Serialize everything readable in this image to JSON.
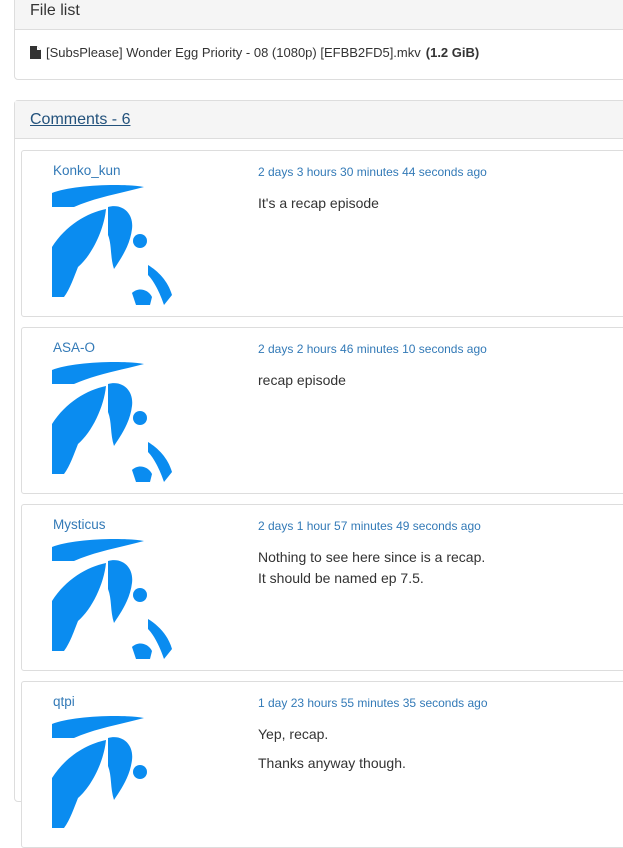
{
  "file_list": {
    "heading": "File list",
    "file_name": "[SubsPlease] Wonder Egg Priority - 08 (1080p) [EFBB2FD5].mkv",
    "file_size": "(1.2 GiB)"
  },
  "comments_panel": {
    "heading": "Comments - 6"
  },
  "comments": [
    {
      "user": "Konko_kun",
      "time": "2 days 3 hours 30 minutes 44 seconds ago",
      "lines": [
        "It's a recap episode"
      ]
    },
    {
      "user": "ASA-O",
      "time": "2 days 2 hours 46 minutes 10 seconds ago",
      "lines": [
        "recap episode"
      ]
    },
    {
      "user": "Mysticus",
      "time": "2 days 1 hour 57 minutes 49 seconds ago",
      "lines": [
        "Nothing to see here since is a recap.",
        "It should be named ep 7.5."
      ]
    },
    {
      "user": "qtpi",
      "time": "1 day 23 hours 55 minutes 35 seconds ago",
      "lines": [
        "Yep, recap.",
        "Thanks anyway though."
      ]
    }
  ],
  "colors": {
    "link": "#337ab7",
    "avatar": "#0a8cf0"
  }
}
